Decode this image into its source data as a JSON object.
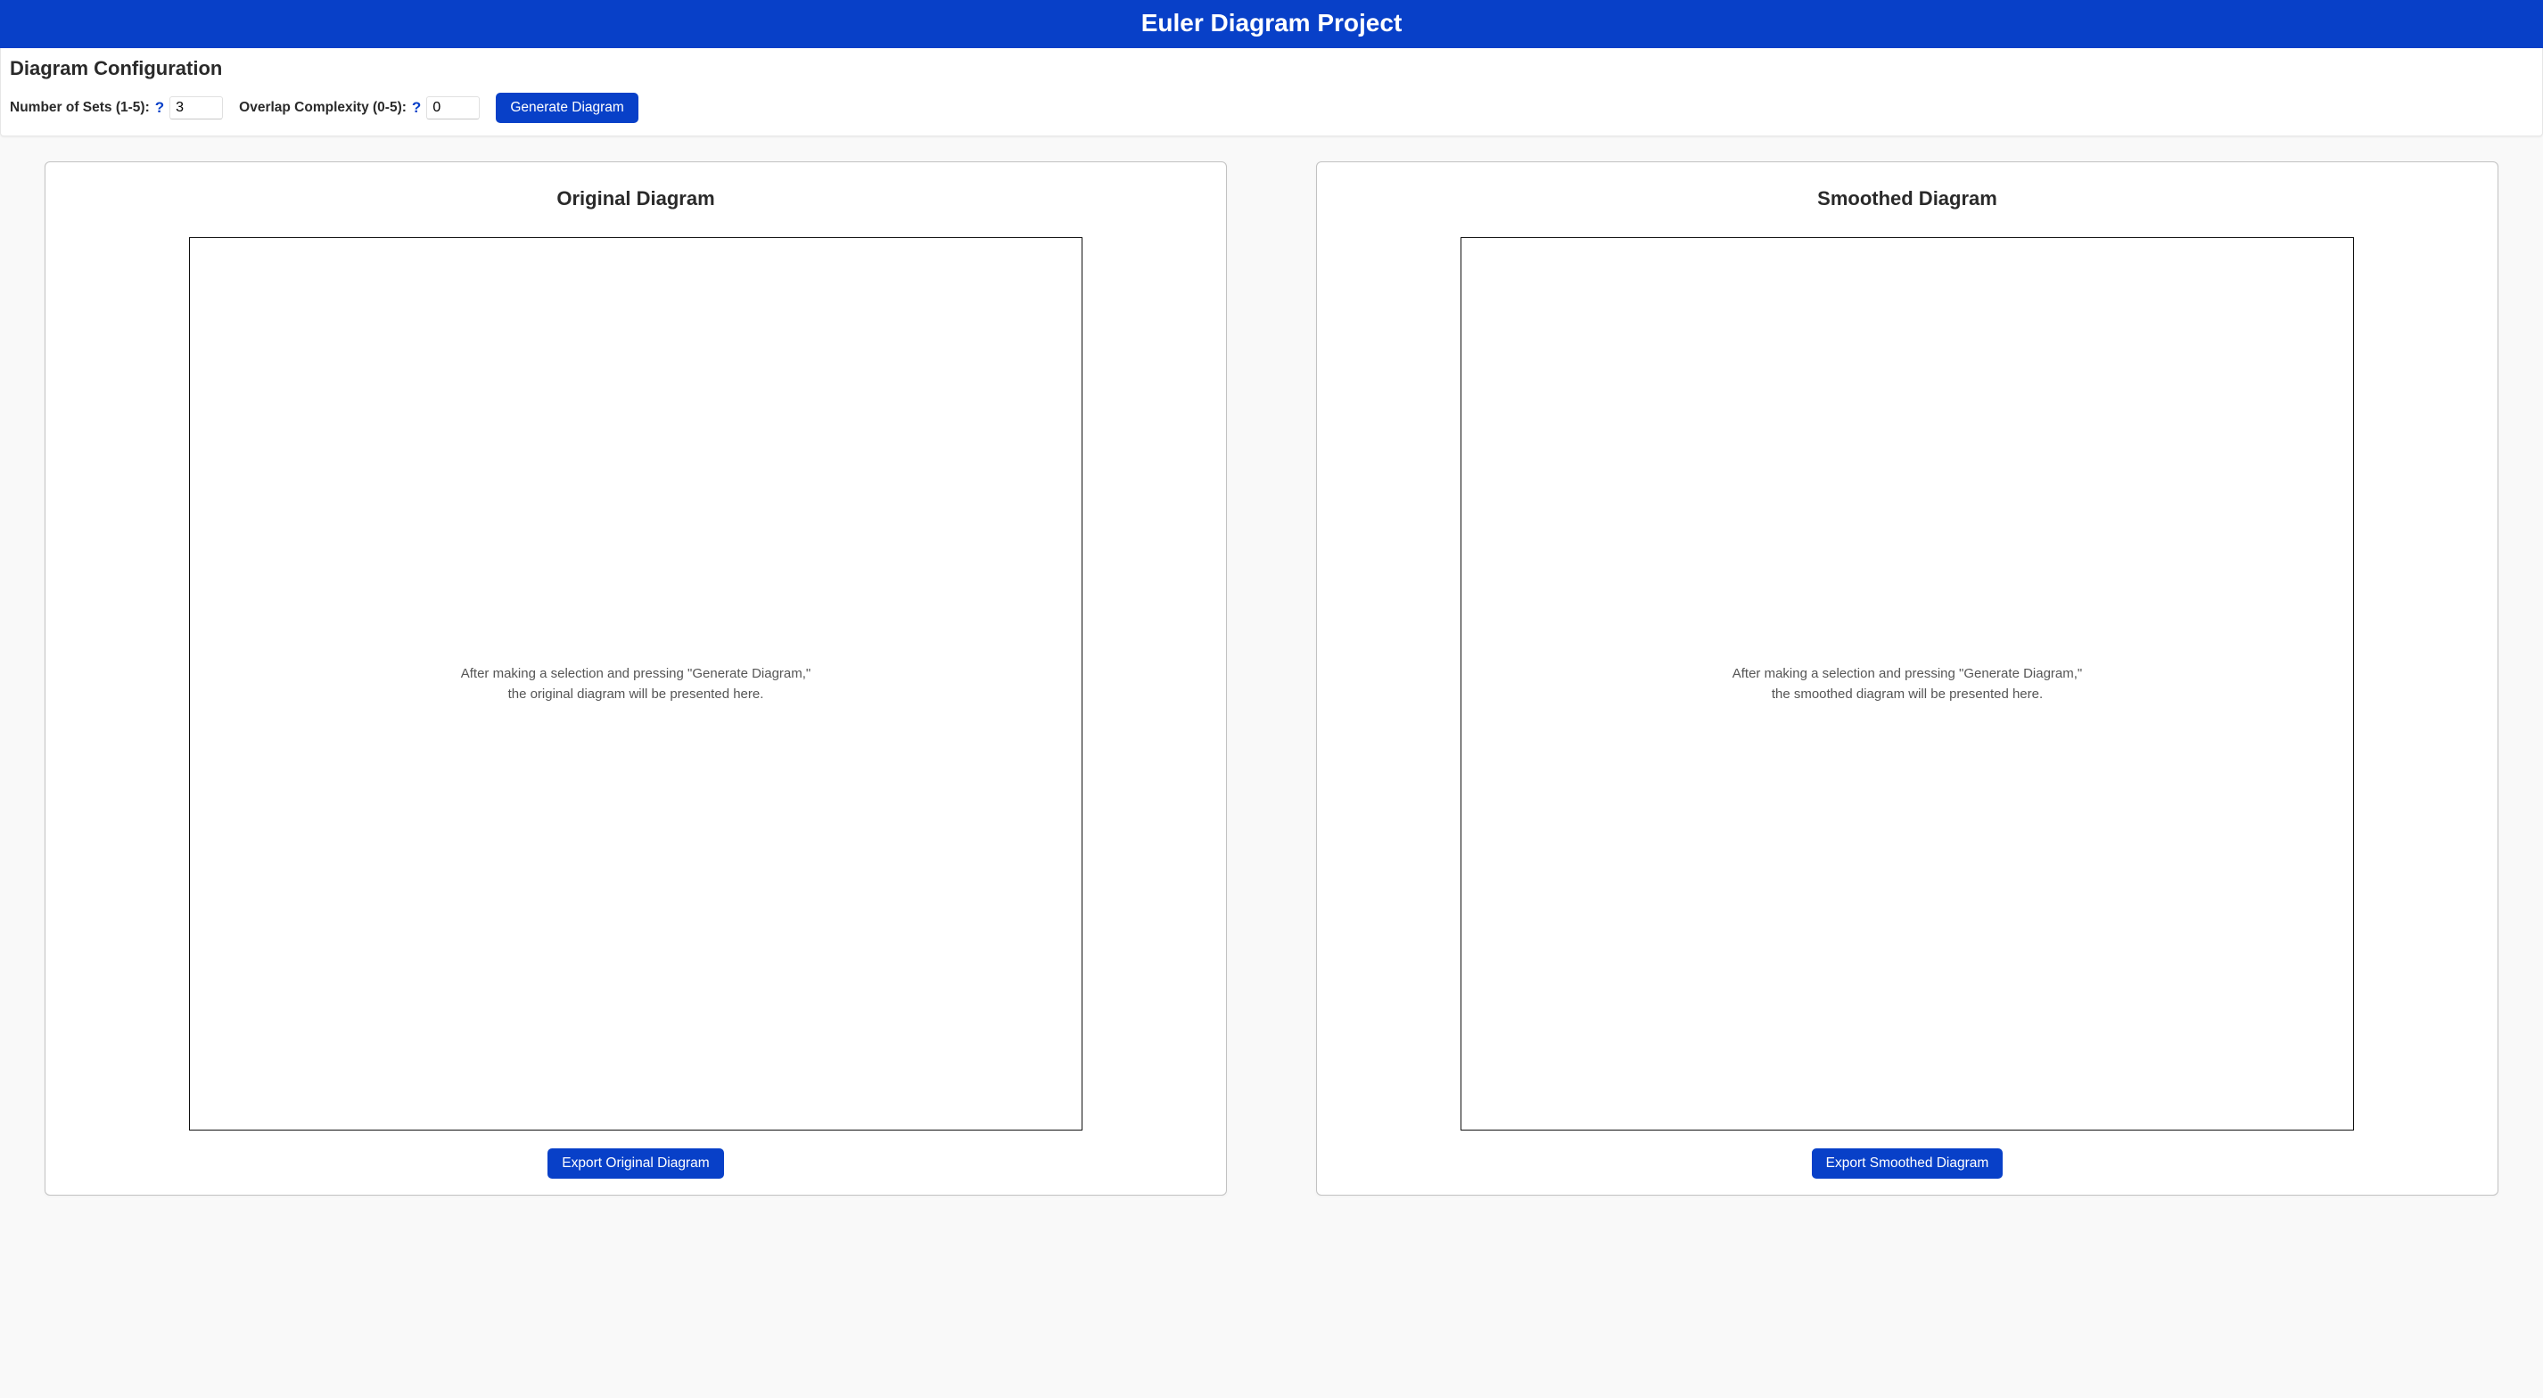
{
  "header": {
    "title": "Euler Diagram Project"
  },
  "config": {
    "panel_title": "Diagram Configuration",
    "num_sets": {
      "label": "Number of Sets (1-5):",
      "help": "?",
      "value": "3",
      "min": "1",
      "max": "5"
    },
    "overlap": {
      "label": "Overlap Complexity (0-5):",
      "help": "?",
      "value": "0",
      "min": "0",
      "max": "5"
    },
    "generate_label": "Generate Diagram"
  },
  "original": {
    "title": "Original Diagram",
    "placeholder_line1": "After making a selection and pressing \"Generate Diagram,\"",
    "placeholder_line2": "the original diagram will be presented here.",
    "export_label": "Export Original Diagram"
  },
  "smoothed": {
    "title": "Smoothed Diagram",
    "placeholder_line1": "After making a selection and pressing \"Generate Diagram,\"",
    "placeholder_line2": "the smoothed diagram will be presented here.",
    "export_label": "Export Smoothed Diagram"
  }
}
